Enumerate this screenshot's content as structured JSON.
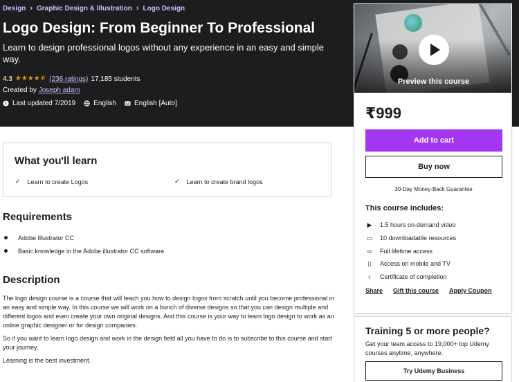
{
  "breadcrumb": [
    "Design",
    "Graphic Design & Illustration",
    "Logo Design"
  ],
  "course": {
    "title": "Logo Design: From Beginner To Professional",
    "subtitle": "Learn to design professional logos without any experience in an easy and simple way.",
    "rating": "4.3",
    "stars": "★★★★⯪",
    "ratings_count": "(236 ratings)",
    "students": "17,185 students",
    "created_by_label": "Created by",
    "author": "Joseph adam",
    "last_updated": "Last updated 7/2019",
    "language": "English",
    "captions": "English [Auto]"
  },
  "sidebar": {
    "preview_label": "Preview this course",
    "price": "₹999",
    "add_to_cart": "Add to cart",
    "buy_now": "Buy now",
    "guarantee": "30-Day Money-Back Guarantee",
    "includes_title": "This course includes:",
    "includes": [
      {
        "icon": "video-icon",
        "glyph": "▶",
        "text": "1.5 hours on-demand video"
      },
      {
        "icon": "file-icon",
        "glyph": "▭",
        "text": "10 downloadable resources"
      },
      {
        "icon": "infinity-icon",
        "glyph": "∞",
        "text": "Full lifetime access"
      },
      {
        "icon": "mobile-icon",
        "glyph": "▯",
        "text": "Access on mobile and TV"
      },
      {
        "icon": "trophy-icon",
        "glyph": "♁",
        "text": "Certificate of completion"
      }
    ],
    "links": [
      "Share",
      "Gift this course",
      "Apply Coupon"
    ],
    "business": {
      "title": "Training 5 or more people?",
      "text": "Get your team access to 19,000+ top Udemy courses anytime, anywhere.",
      "button": "Try Udemy Business"
    }
  },
  "learn": {
    "title": "What you'll learn",
    "items": [
      "Learn to create Logos",
      "Learn to create brand logos"
    ]
  },
  "requirements": {
    "title": "Requirements",
    "items": [
      "Adobe Illustrator CC",
      "Basic knowledge in the Adobe illustrator CC software"
    ]
  },
  "description": {
    "title": "Description",
    "paragraphs": [
      "The logo design course is a course that will teach you how to design logos from scratch until you become professional in an easy and simple way. In this course we will work on a bunch of diverse designs so that you can design multiple and different logos and even create your own original designs. And this course is your way to learn logo design to work as an online graphic designer or for design companies.",
      "So if you want to learn logo design and work in the design field all you have to do is to subscribe to this course and start your journey.",
      "Learning is the best investment."
    ]
  },
  "colors": {
    "hero_bg": "#1c1d1f",
    "accent_purple": "#a435f0",
    "link_lavender": "#cec0fc",
    "rating_gold": "#f3ca8c",
    "star": "#e59819"
  }
}
